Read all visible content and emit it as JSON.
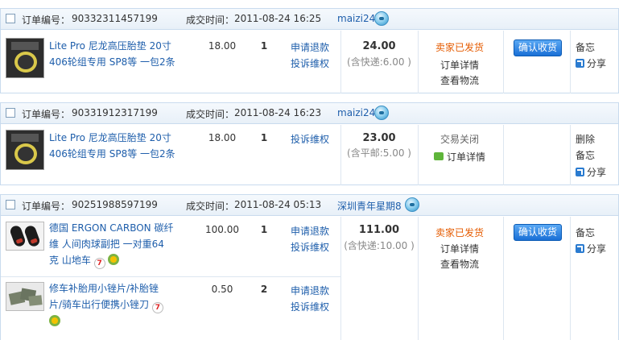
{
  "labels": {
    "order_no": "订单编号：",
    "deal_time": "成交时间：",
    "apply_refund": "申请退款",
    "complain": "投诉维权",
    "order_detail": "订单详情",
    "view_logistics": "查看物流",
    "confirm_receipt": "确认收货",
    "memo": "备忘",
    "share": "分享",
    "delete": "删除"
  },
  "orders": [
    {
      "order_no": "90332311457199",
      "deal_time": "2011-08-24 16:25",
      "seller": "maizi24",
      "items": [
        {
          "title_l1": "Lite Pro 尼龙高压胎垫 20寸",
          "title_l2": "406轮组专用 SP8等 一包2条",
          "price": "18.00",
          "qty": "1"
        }
      ],
      "total": "24.00",
      "shipping": "(含快递:6.00 )",
      "status": "卖家已发货"
    },
    {
      "order_no": "90331912317199",
      "deal_time": "2011-08-24 16:23",
      "seller": "maizi24",
      "items": [
        {
          "title_l1": "Lite Pro 尼龙高压胎垫 20寸",
          "title_l2": "406轮组专用 SP8等 一包2条",
          "price": "18.00",
          "qty": "1"
        }
      ],
      "total": "23.00",
      "shipping": "(含平邮:5.00 )",
      "status": "交易关闭"
    },
    {
      "order_no": "90251988597199",
      "deal_time": "2011-08-24 05:13",
      "seller": "深圳青年星期8",
      "items": [
        {
          "title_l1": "德国 ERGON CARBON 碳纤",
          "title_l2": "维 人间肉球副把 一对重64",
          "title_l3": "克 山地车",
          "price": "100.00",
          "qty": "1"
        },
        {
          "title_l1": "修车补胎用小锉片/补胎锉",
          "title_l2": "片/骑车出行便携小锉刀",
          "price": "0.50",
          "qty": "2"
        }
      ],
      "total": "111.00",
      "shipping": "(含快递:10.00 )",
      "status": "卖家已发货"
    }
  ],
  "badges": {
    "seven": "7"
  }
}
